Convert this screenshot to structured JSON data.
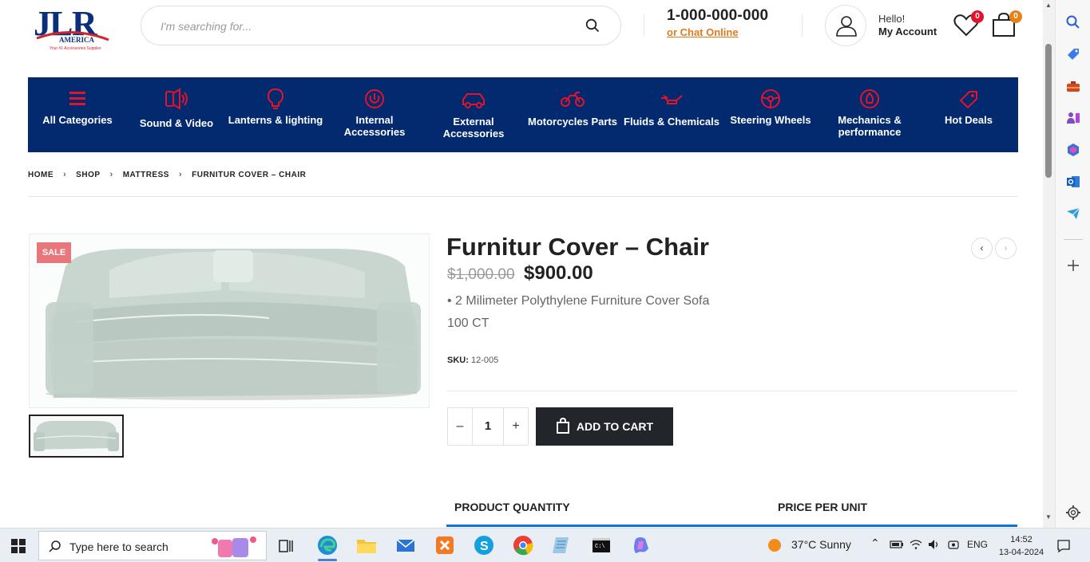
{
  "header": {
    "logo_text": "JLR AMERICA",
    "logo_tagline": "Your #1 Accessories Supplier",
    "search_placeholder": "I'm searching for...",
    "phone": "1-000-000-000",
    "chat_link": "or Chat Online",
    "hello": "Hello!",
    "account_label": "My Account",
    "wishlist_count": "0",
    "cart_count": "0"
  },
  "nav": {
    "items": [
      {
        "label": "All Categories",
        "icon": "menu-icon"
      },
      {
        "label": "Sound & Video",
        "icon": "speaker-icon"
      },
      {
        "label": "Lanterns & lighting",
        "icon": "bulb-icon"
      },
      {
        "label": "Internal Accessories",
        "icon": "power-icon"
      },
      {
        "label": "External Accessories",
        "icon": "car-icon"
      },
      {
        "label": "Motorcycles Parts",
        "icon": "motorcycle-icon"
      },
      {
        "label": "Fluids & Chemicals",
        "icon": "oil-can-icon"
      },
      {
        "label": "Steering Wheels",
        "icon": "steering-wheel-icon"
      },
      {
        "label": "Mechanics & performance",
        "icon": "gauge-icon"
      },
      {
        "label": "Hot Deals",
        "icon": "tag-icon"
      }
    ]
  },
  "breadcrumb": {
    "items": [
      "HOME",
      "SHOP",
      "MATTRESS",
      "FURNITUR COVER – CHAIR"
    ]
  },
  "product": {
    "sale_badge": "SALE",
    "title": "Furnitur Cover – Chair",
    "old_price": "$1,000.00",
    "price": "$900.00",
    "desc_line1": "• 2 Milimeter Polythylene Furniture Cover Sofa",
    "desc_line2": "100 CT",
    "sku_label": "SKU:",
    "sku_value": "12-005",
    "qty_minus": "–",
    "qty_value": "1",
    "qty_plus": "+",
    "add_to_cart": "ADD TO CART",
    "table_col1": "PRODUCT QUANTITY",
    "table_col2": "PRICE PER UNIT",
    "prev_arrow": "‹",
    "next_arrow": "›"
  },
  "taskbar": {
    "search_text": "Type here to search",
    "weather": "37°C  Sunny",
    "lang": "ENG",
    "time": "14:52",
    "date": "13-04-2024"
  },
  "colors": {
    "nav_bg": "#032a6e",
    "nav_icon": "#e3132c",
    "accent_orange": "#e8801a",
    "sale_bg": "#e9767a",
    "button_dark": "#222529"
  }
}
